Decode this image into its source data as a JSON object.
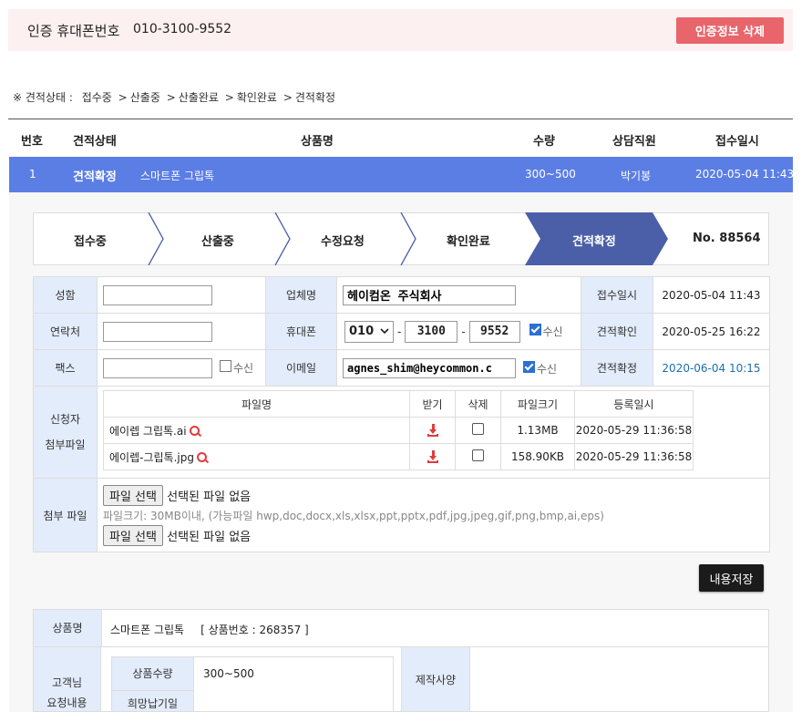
{
  "auth": {
    "label": "인증 휴대폰번호",
    "phone": "010-3100-9552",
    "delete_button": "인증정보 삭제"
  },
  "legend": {
    "prefix": "※ 견적상태 :",
    "states": [
      "접수중",
      "산출중",
      "산출완료",
      "확인완료",
      "견적확정"
    ],
    "arrow": ">"
  },
  "list": {
    "headers": {
      "no": "번호",
      "status": "견적상태",
      "product": "상품명",
      "qty": "수량",
      "staff": "상담직원",
      "date": "접수일시"
    },
    "row": {
      "no": "1",
      "status": "견적확정",
      "product": "스마트폰 그립톡",
      "qty": "300~500",
      "staff": "박기봉",
      "date": "2020-05-04 11:43"
    }
  },
  "steps": {
    "items": [
      "접수중",
      "산출중",
      "수정요청",
      "확인완료",
      "견적확정"
    ],
    "active_index": 4,
    "number": "No. 88564"
  },
  "form": {
    "name_label": "성함",
    "company_label": "업체명",
    "company_value": "헤이컴온 주식회사",
    "received_label": "접수일시",
    "received_value": "2020-05-04 11:43",
    "contact_label": "연락처",
    "mobile_label": "휴대폰",
    "mobile_prefix": "010",
    "mobile_mid": "3100",
    "mobile_last": "9552",
    "receive_text": "수신",
    "confirm_label": "견적확인",
    "confirm_value": "2020-05-25 16:22",
    "fax_label": "팩스",
    "email_label": "이메일",
    "email_value": "agnes_shim@heycommon.c",
    "fixed_label": "견적확정",
    "fixed_value": "2020-06-04 10:15",
    "applicant_label_1": "신청자",
    "applicant_label_2": "첨부파일",
    "attach_label": "첨부 파일"
  },
  "files": {
    "headers": {
      "name": "파일명",
      "download": "받기",
      "delete": "삭제",
      "size": "파일크기",
      "date": "등록일시"
    },
    "rows": [
      {
        "name": "에이렙 그립톡.ai",
        "size": "1.13MB",
        "date": "2020-05-29 11:36:58"
      },
      {
        "name": "에이렙-그립톡.jpg",
        "size": "158.90KB",
        "date": "2020-05-29 11:36:58"
      }
    ]
  },
  "attach": {
    "button": "파일 선택",
    "none": "선택된 파일 없음",
    "note": "파일크기: 30MB이내, (가능파일 hwp,doc,docx,xls,xlsx,ppt,pptx,pdf,jpg,jpeg,gif,png,bmp,ai,eps)"
  },
  "save_button": "내용저장",
  "product": {
    "label": "상품명",
    "name": "스마트폰 그립톡",
    "code": "[ 상품번호 : 268357 ]",
    "request_label_1": "고객님",
    "request_label_2": "요청내용",
    "qty_label": "상품수량",
    "qty_value": "300~500",
    "partial_label": "희망납기일",
    "spec_label": "제작사양"
  },
  "colors": {
    "accent_blue": "#5b7ee5",
    "step_active": "#4a5fa8",
    "delete_red": "#e9656c",
    "label_bg": "#e3ecfa"
  }
}
